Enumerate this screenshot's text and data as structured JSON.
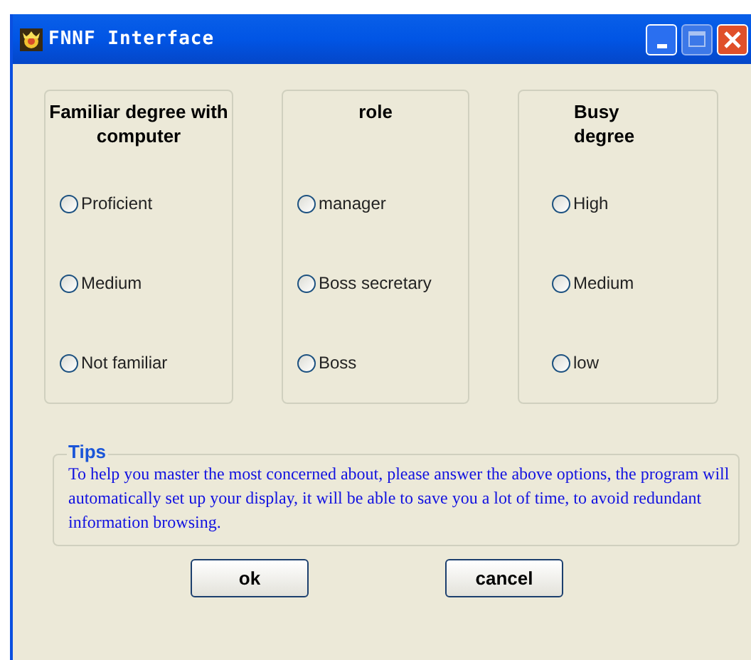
{
  "window": {
    "title": "FNNF Interface"
  },
  "groups": [
    {
      "title": "Familiar degree with computer",
      "options": [
        {
          "label": "Proficient",
          "selected": false
        },
        {
          "label": "Medium",
          "selected": false
        },
        {
          "label": "Not familiar",
          "selected": false
        }
      ]
    },
    {
      "title": "role",
      "options": [
        {
          "label": "manager",
          "selected": false
        },
        {
          "label": "Boss secretary",
          "selected": false
        },
        {
          "label": "Boss",
          "selected": false
        }
      ]
    },
    {
      "title": "Busy degree",
      "options": [
        {
          "label": "High",
          "selected": false
        },
        {
          "label": "Medium",
          "selected": false
        },
        {
          "label": "low",
          "selected": false
        }
      ]
    }
  ],
  "tips": {
    "title": "Tips",
    "text": "To help you master the most concerned about, please answer the above options, the program will automatically set up your display, it will be able to save you a lot of time, to avoid redundant information browsing."
  },
  "buttons": [
    "ok",
    "cancel"
  ]
}
